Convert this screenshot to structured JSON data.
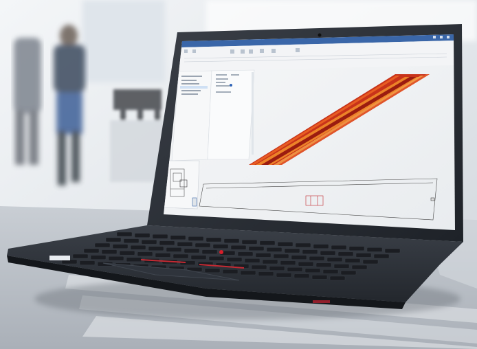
{
  "app": {
    "window_title": "",
    "menu_tabs": [],
    "toolbar_buttons": [],
    "tree_items": []
  },
  "colors": {
    "title_bar": "#3a66a8",
    "heatmap_dark": "#9b1c10",
    "heatmap_mid": "#d3401b",
    "heatmap_light": "#f08b2a",
    "laptop_body": "#2b2f36",
    "keyboard_key": "#1b1d22",
    "trackpoint": "#d81e2a"
  },
  "icons": [
    "window-minimize-icon",
    "window-maximize-icon",
    "window-close-icon",
    "trackpoint-icon"
  ]
}
